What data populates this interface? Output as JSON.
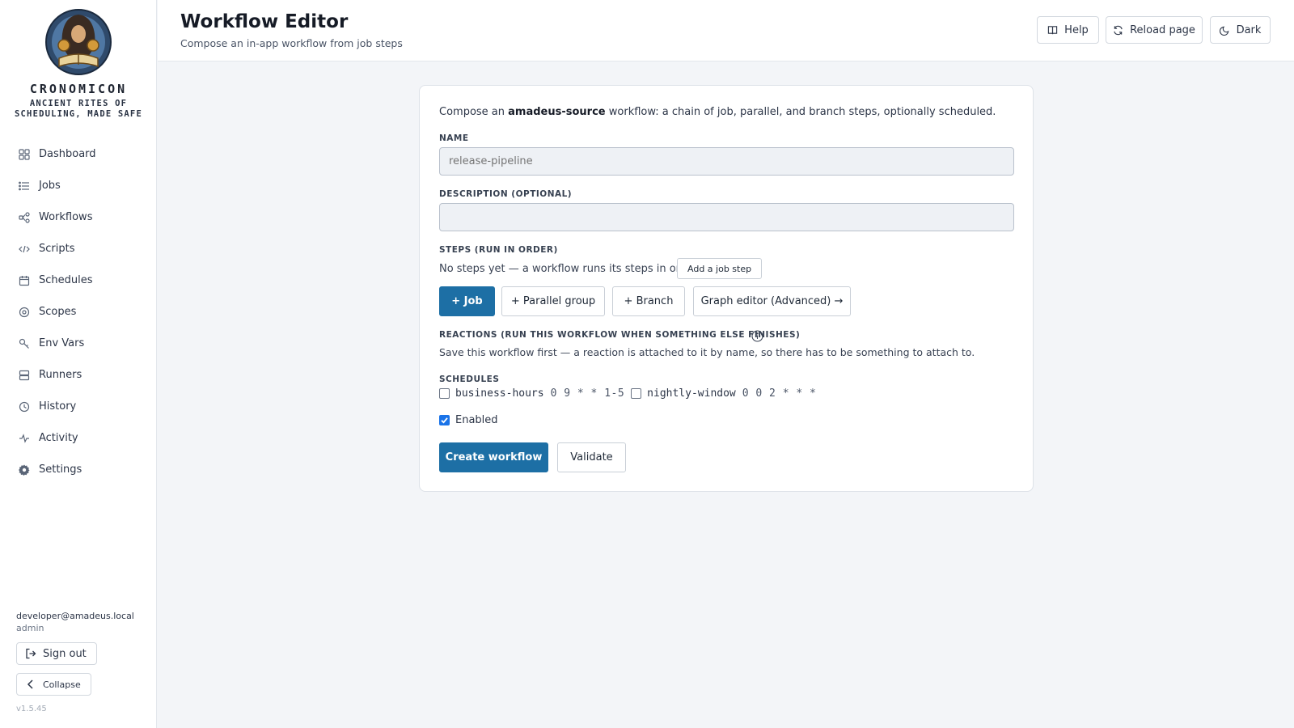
{
  "app": {
    "name": "CRONOMICON",
    "tagline": "ANCIENT RITES OF SCHEDULING, MADE SAFE",
    "version": "v1.5.45",
    "accent_color": "#1d6fa5"
  },
  "sidebar": {
    "items": [
      {
        "label": "Dashboard",
        "icon": "grid-icon"
      },
      {
        "label": "Jobs",
        "icon": "list-icon"
      },
      {
        "label": "Workflows",
        "icon": "workflow-icon"
      },
      {
        "label": "Scripts",
        "icon": "code-icon"
      },
      {
        "label": "Schedules",
        "icon": "calendar-icon"
      },
      {
        "label": "Scopes",
        "icon": "target-icon"
      },
      {
        "label": "Env Vars",
        "icon": "key-icon"
      },
      {
        "label": "Runners",
        "icon": "server-icon"
      },
      {
        "label": "History",
        "icon": "clock-icon"
      },
      {
        "label": "Activity",
        "icon": "pulse-icon"
      },
      {
        "label": "Settings",
        "icon": "gear-icon"
      }
    ],
    "user_email": "developer@amadeus.local",
    "user_role": "admin",
    "sign_out_label": "Sign out",
    "collapse_label": "Collapse"
  },
  "header": {
    "title": "Workflow Editor",
    "subtitle": "Compose an in-app workflow from job steps",
    "help_label": "Help",
    "reload_label": "Reload page",
    "theme_label": "Dark"
  },
  "form": {
    "intro_prefix": "Compose an ",
    "intro_scope": "amadeus-source",
    "intro_suffix": " workflow: a chain of job, parallel, and branch steps, optionally scheduled.",
    "name_label": "NAME",
    "name_placeholder": "release-pipeline",
    "description_label": "DESCRIPTION (OPTIONAL)",
    "description_value": "",
    "steps_label": "STEPS (RUN IN ORDER)",
    "steps_empty": "No steps yet — a workflow runs its steps in order.",
    "add_job_step_label": "Add a job step",
    "step_buttons": {
      "job": "+ Job",
      "parallel": "+ Parallel group",
      "branch": "+ Branch",
      "graph": "Graph editor (Advanced) →"
    },
    "reactions_label": "REACTIONS (RUN THIS WORKFLOW WHEN SOMETHING ELSE FINISHES)",
    "reactions_note": "Save this workflow first — a reaction is attached to it by name, so there has to be something to attach to.",
    "schedules_label": "SCHEDULES",
    "schedules": [
      {
        "name": "business-hours",
        "cron": "0 9 * * 1-5",
        "checked": false
      },
      {
        "name": "nightly-window",
        "cron": "0 0 2 * * *",
        "checked": false
      }
    ],
    "enabled_label": "Enabled",
    "enabled_checked": true,
    "create_label": "Create workflow",
    "validate_label": "Validate"
  }
}
